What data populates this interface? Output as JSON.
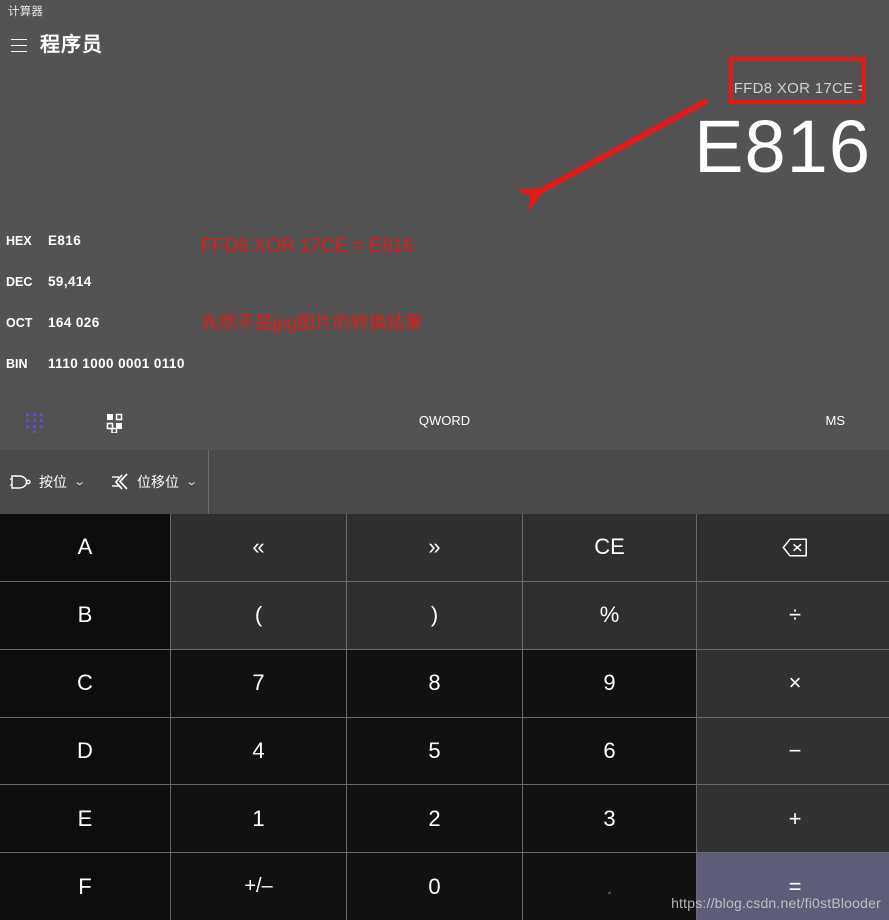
{
  "window": {
    "title": "计算器"
  },
  "header": {
    "menu_icon": "hamburger-icon",
    "mode": "程序员"
  },
  "display": {
    "expression": "FFD8 XOR 17CE =",
    "result": "E816",
    "bases": [
      {
        "label": "HEX",
        "value": "E816"
      },
      {
        "label": "DEC",
        "value": "59,414"
      },
      {
        "label": "OCT",
        "value": "164 026"
      },
      {
        "label": "BIN",
        "value": "1110 1000 0001 0110"
      }
    ]
  },
  "options": {
    "keypad_icon": "keypad-icon",
    "bit_toggle_icon": "bit-toggle-icon",
    "word_size": "QWORD",
    "memory": "MS"
  },
  "dropdowns": [
    {
      "label": "按位",
      "icon": "logic-gate-icon",
      "chevron": "⌄"
    },
    {
      "label": "位移位",
      "icon": "bit-shift-icon",
      "chevron": "⌄"
    }
  ],
  "keypad": {
    "rows": [
      [
        {
          "label": "A",
          "kind": "hexkey"
        },
        {
          "label": "«",
          "kind": "fnkey"
        },
        {
          "label": "»",
          "kind": "fnkey"
        },
        {
          "label": "CE",
          "kind": "fnkey"
        },
        {
          "label": "",
          "kind": "fnkey",
          "icon": "backspace-icon"
        }
      ],
      [
        {
          "label": "B",
          "kind": "hexkey"
        },
        {
          "label": "(",
          "kind": "fnkey"
        },
        {
          "label": ")",
          "kind": "fnkey"
        },
        {
          "label": "%",
          "kind": "fnkey"
        },
        {
          "label": "÷",
          "kind": "opkey"
        }
      ],
      [
        {
          "label": "C",
          "kind": "hexkey"
        },
        {
          "label": "7",
          "kind": "numkey"
        },
        {
          "label": "8",
          "kind": "numkey"
        },
        {
          "label": "9",
          "kind": "numkey"
        },
        {
          "label": "×",
          "kind": "opkey"
        }
      ],
      [
        {
          "label": "D",
          "kind": "hexkey"
        },
        {
          "label": "4",
          "kind": "numkey"
        },
        {
          "label": "5",
          "kind": "numkey"
        },
        {
          "label": "6",
          "kind": "numkey"
        },
        {
          "label": "−",
          "kind": "opkey"
        }
      ],
      [
        {
          "label": "E",
          "kind": "hexkey"
        },
        {
          "label": "1",
          "kind": "numkey"
        },
        {
          "label": "2",
          "kind": "numkey"
        },
        {
          "label": "3",
          "kind": "numkey"
        },
        {
          "label": "+",
          "kind": "opkey"
        }
      ],
      [
        {
          "label": "F",
          "kind": "hexkey"
        },
        {
          "label": "+/–",
          "kind": "numkey"
        },
        {
          "label": "0",
          "kind": "numkey"
        },
        {
          "label": ".",
          "kind": "numkey disabled"
        },
        {
          "label": "=",
          "kind": "equals"
        }
      ]
    ]
  },
  "annotations": {
    "line1": "FFD8 XOR 17CE = E816",
    "line2": "先然不是jpg图片的转换结果",
    "box_color": "#e81818",
    "arrow_color": "#e01d1d"
  },
  "watermark": "https://blog.csdn.net/fi0stBlooder"
}
